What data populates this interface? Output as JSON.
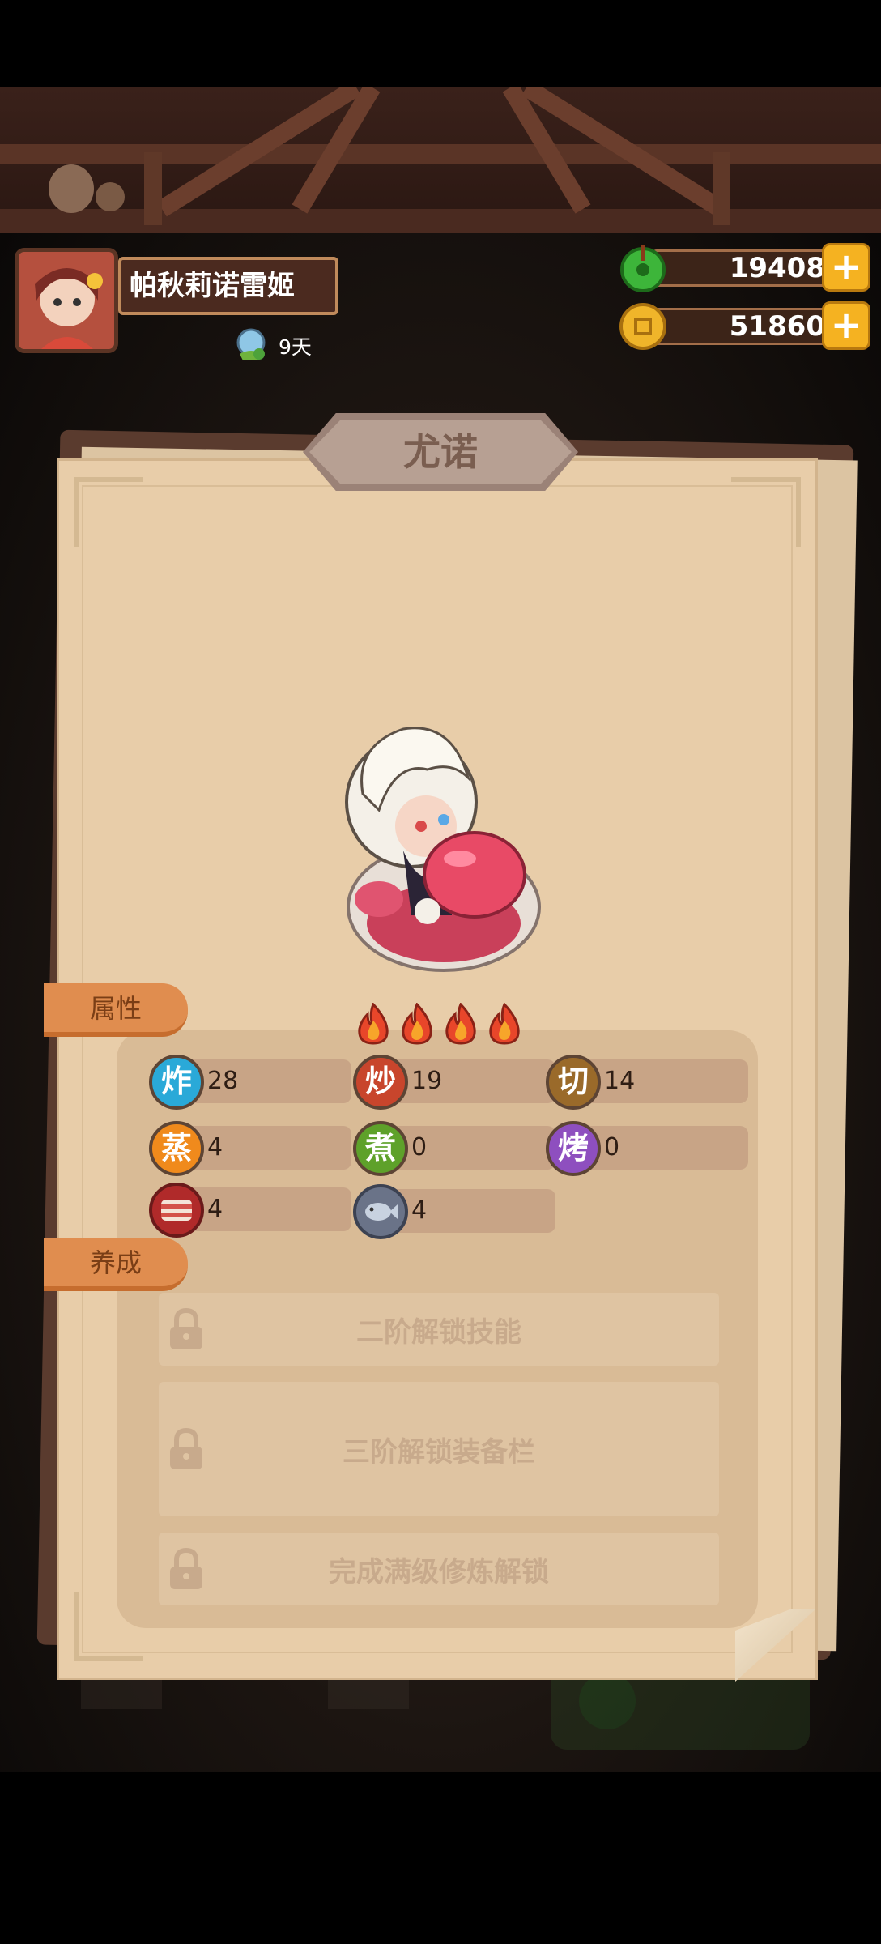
{
  "player": {
    "name": "帕秋莉诺雷姬",
    "days": "9天"
  },
  "currencies": [
    {
      "name": "jade",
      "value": "19408",
      "plus": "+"
    },
    {
      "name": "coins",
      "value": "51860",
      "plus": "+"
    }
  ],
  "character": {
    "name": "尤诺",
    "star_level": 4
  },
  "sections": {
    "attributes_label": "属性",
    "training_label": "养成"
  },
  "stats": [
    {
      "icon": "炸",
      "value": "28",
      "color": "#2aa9d8"
    },
    {
      "icon": "炒",
      "value": "19",
      "color": "#c8452c"
    },
    {
      "icon": "切",
      "value": "14",
      "color": "#9a6a2a"
    },
    {
      "icon": "蒸",
      "value": "4",
      "color": "#f08a1c"
    },
    {
      "icon": "煮",
      "value": "0",
      "color": "#5ea12a"
    },
    {
      "icon": "烤",
      "value": "0",
      "color": "#8e4fbf"
    },
    {
      "icon": "bacon-icon",
      "value": "4",
      "color": "#b02a2a"
    },
    {
      "icon": "fish-icon",
      "value": "4",
      "color": "#6a7388"
    }
  ],
  "locked_features": [
    "二阶解锁技能",
    "三阶解锁装备栏",
    "完成满级修炼解锁"
  ],
  "colors": {
    "panel": "#e8cda9",
    "tab": "#e08d4f",
    "plus_button": "#f5b221"
  }
}
